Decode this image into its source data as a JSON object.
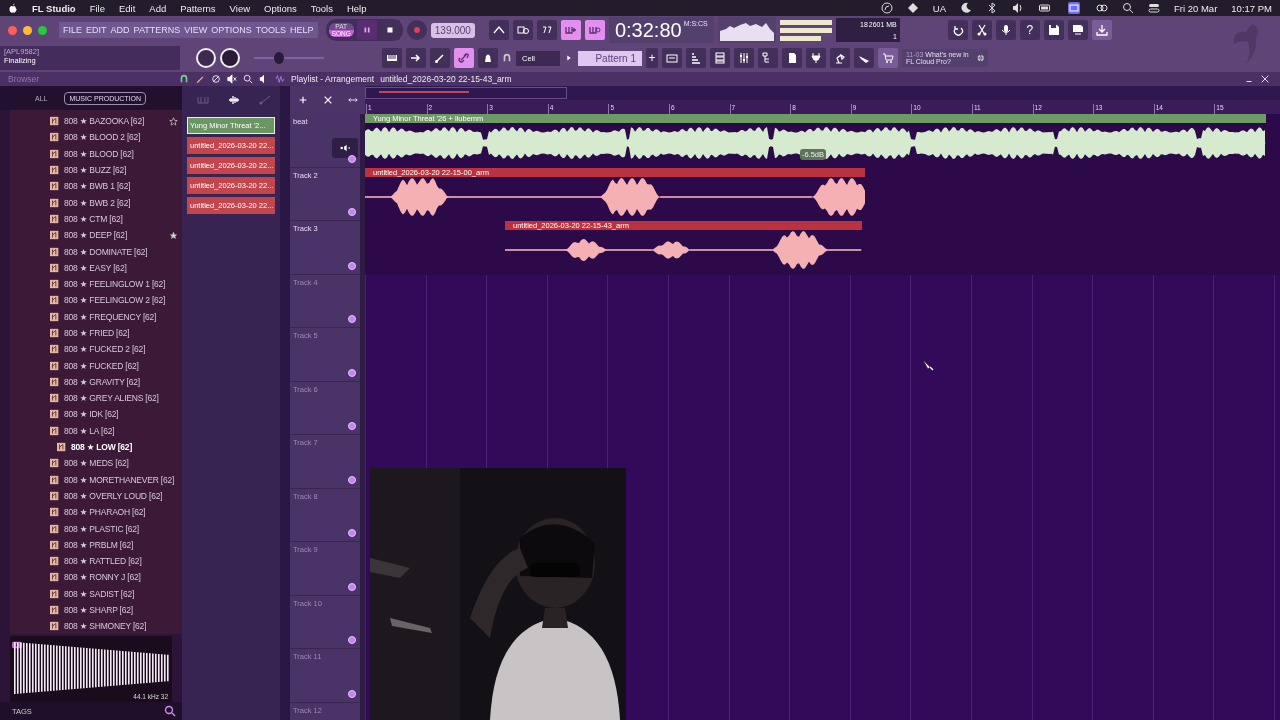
{
  "menubar": {
    "app_name": "FL Studio",
    "menus": [
      "File",
      "Edit",
      "Add",
      "Patterns",
      "View",
      "Options",
      "Tools",
      "Help"
    ],
    "status_text": "UA",
    "date": "Fri 20 Mar",
    "time": "10:17 PM"
  },
  "toolbar": {
    "menu": [
      "FILE",
      "EDIT",
      "ADD",
      "PATTERNS",
      "VIEW",
      "OPTIONS",
      "TOOLS",
      "HELP"
    ],
    "modes": [
      {
        "label": "PAT",
        "selected": false
      },
      {
        "label": "SONG",
        "selected": true
      }
    ],
    "tempo": "139.000",
    "tempo_slider": {
      "level": 0.35
    },
    "time": "0:32:80",
    "time_format": "M:S:CS",
    "cpu": "18",
    "memory": "2601 MB",
    "polyphony": "1",
    "hint_title": "[APL9582]",
    "hint": "Finalizing",
    "mode_buttons": [
      {
        "on": false
      },
      {
        "on": false
      },
      {
        "on": false
      },
      {
        "on": true
      },
      {
        "on": true
      }
    ],
    "tool_buttons": [
      {
        "on": false
      },
      {
        "on": false
      },
      {
        "on": false
      },
      {
        "on": true
      },
      {
        "on": false
      }
    ],
    "help_glyph": "?",
    "snap": "Cell",
    "pattern": "Pattern 1",
    "add_glyph": "+",
    "news_date": "11-03",
    "news": "What's new in FL Cloud Pro?"
  },
  "breadcrumb": {
    "browser": "Browser",
    "window": "Playlist - Arrangement",
    "file": "untitled_2026-03-20 22-15-43_arm"
  },
  "browser": {
    "tabs": [
      {
        "label": "ALL",
        "selected": false
      },
      {
        "label": "MUSIC PRODUCTION",
        "selected": true
      }
    ],
    "items": [
      {
        "label": "808 ★ BAZOOKA [62]",
        "selected": false,
        "hovered": true,
        "starred": false
      },
      {
        "label": "808 ★ BLOOD 2 [62]",
        "selected": false,
        "hovered": false,
        "starred": false
      },
      {
        "label": "808 ★ BLOOD [62]",
        "selected": false,
        "hovered": false,
        "starred": false
      },
      {
        "label": "808 ★ BUZZ [62]",
        "selected": false,
        "hovered": false,
        "starred": false
      },
      {
        "label": "808 ★ BWB 1 [62]",
        "selected": false,
        "hovered": false,
        "starred": false
      },
      {
        "label": "808 ★ BWB 2 [62]",
        "selected": false,
        "hovered": false,
        "starred": false
      },
      {
        "label": "808 ★ CTM [62]",
        "selected": false,
        "hovered": false,
        "starred": false
      },
      {
        "label": "808 ★ DEEP [62]",
        "selected": false,
        "hovered": false,
        "starred": true
      },
      {
        "label": "808 ★ DOMINATE [62]",
        "selected": false,
        "hovered": false,
        "starred": false
      },
      {
        "label": "808 ★ EASY [62]",
        "selected": false,
        "hovered": false,
        "starred": false
      },
      {
        "label": "808 ★ FEELINGLOW 1 [62]",
        "selected": false,
        "hovered": false,
        "starred": false
      },
      {
        "label": "808 ★ FEELINGLOW 2 [62]",
        "selected": false,
        "hovered": false,
        "starred": false
      },
      {
        "label": "808 ★ FREQUENCY [62]",
        "selected": false,
        "hovered": false,
        "starred": false
      },
      {
        "label": "808 ★ FRIED [62]",
        "selected": false,
        "hovered": false,
        "starred": false
      },
      {
        "label": "808 ★ FUCKED 2 [62]",
        "selected": false,
        "hovered": false,
        "starred": false
      },
      {
        "label": "808 ★ FUCKED [62]",
        "selected": false,
        "hovered": false,
        "starred": false
      },
      {
        "label": "808 ★ GRAVITY [62]",
        "selected": false,
        "hovered": false,
        "starred": false
      },
      {
        "label": "808 ★ GREY ALIENS [62]",
        "selected": false,
        "hovered": false,
        "starred": false
      },
      {
        "label": "808 ★ IDK [62]",
        "selected": false,
        "hovered": false,
        "starred": false
      },
      {
        "label": "808 ★ LA [62]",
        "selected": false,
        "hovered": false,
        "starred": false
      },
      {
        "label": "808 ★ LOW [62]",
        "selected": true,
        "hovered": false,
        "starred": false
      },
      {
        "label": "808 ★ MEDS [62]",
        "selected": false,
        "hovered": false,
        "starred": false
      },
      {
        "label": "808 ★ MORETHANEVER [62]",
        "selected": false,
        "hovered": false,
        "starred": false
      },
      {
        "label": "808 ★ OVERLY LOUD [62]",
        "selected": false,
        "hovered": false,
        "starred": false
      },
      {
        "label": "808 ★ PHARAOH [62]",
        "selected": false,
        "hovered": false,
        "starred": false
      },
      {
        "label": "808 ★ PLASTIC [62]",
        "selected": false,
        "hovered": false,
        "starred": false
      },
      {
        "label": "808 ★ PRBLM [62]",
        "selected": false,
        "hovered": false,
        "starred": false
      },
      {
        "label": "808 ★ RATTLED [62]",
        "selected": false,
        "hovered": false,
        "starred": false
      },
      {
        "label": "808 ★ RONNY J [62]",
        "selected": false,
        "hovered": false,
        "starred": false
      },
      {
        "label": "808 ★ SADIST [62]",
        "selected": false,
        "hovered": false,
        "starred": false
      },
      {
        "label": "808 ★ SHARP [62]",
        "selected": false,
        "hovered": false,
        "starred": false
      },
      {
        "label": "808 ★ SHMONEY [62]",
        "selected": false,
        "hovered": false,
        "starred": false
      }
    ],
    "sample_rate": "44.1 kHz 32",
    "tags": "TAGS"
  },
  "picker": [
    {
      "label": "Yung Minor Threat '2...",
      "color": "#6b9563",
      "selected": true
    },
    {
      "label": "untitled_2026-03-20 22...",
      "color": "#c2464e",
      "selected": false
    },
    {
      "label": "untitled_2026-03-20 22...",
      "color": "#c2464e",
      "selected": false
    },
    {
      "label": "untitled_2026-03-20 22...",
      "color": "#c2464e",
      "selected": false
    },
    {
      "label": "untitled_2026-03-20 22...",
      "color": "#c2464e",
      "selected": false
    }
  ],
  "playlist": {
    "ruler": [
      "1",
      "2",
      "3",
      "4",
      "5",
      "6",
      "7",
      "8",
      "9",
      "10",
      "11",
      "12",
      "13",
      "14",
      "15"
    ],
    "tracks": [
      {
        "name": "beat",
        "dimmed": false,
        "clips": [
          {
            "title": "Yung Minor Threat '26 + liubemm",
            "color": "#6e9a66",
            "gain": "-6.5dB"
          }
        ]
      },
      {
        "name": "Track 2",
        "dimmed": false,
        "clips": [
          {
            "title": "untitled_2026-03-20 22-15-00_arm",
            "color": "#b8333f"
          }
        ]
      },
      {
        "name": "Track 3",
        "dimmed": false,
        "clips": [
          {
            "title": "untitled_2026-03-20 22-15-43_arm",
            "color": "#b8333f"
          }
        ]
      },
      {
        "name": "Track 4",
        "dimmed": true
      },
      {
        "name": "Track 5",
        "dimmed": true
      },
      {
        "name": "Track 6",
        "dimmed": true
      },
      {
        "name": "Track 7",
        "dimmed": true
      },
      {
        "name": "Track 8",
        "dimmed": true
      },
      {
        "name": "Track 9",
        "dimmed": true
      },
      {
        "name": "Track 10",
        "dimmed": true
      },
      {
        "name": "Track 11",
        "dimmed": true
      },
      {
        "name": "Track 12",
        "dimmed": true
      }
    ]
  }
}
